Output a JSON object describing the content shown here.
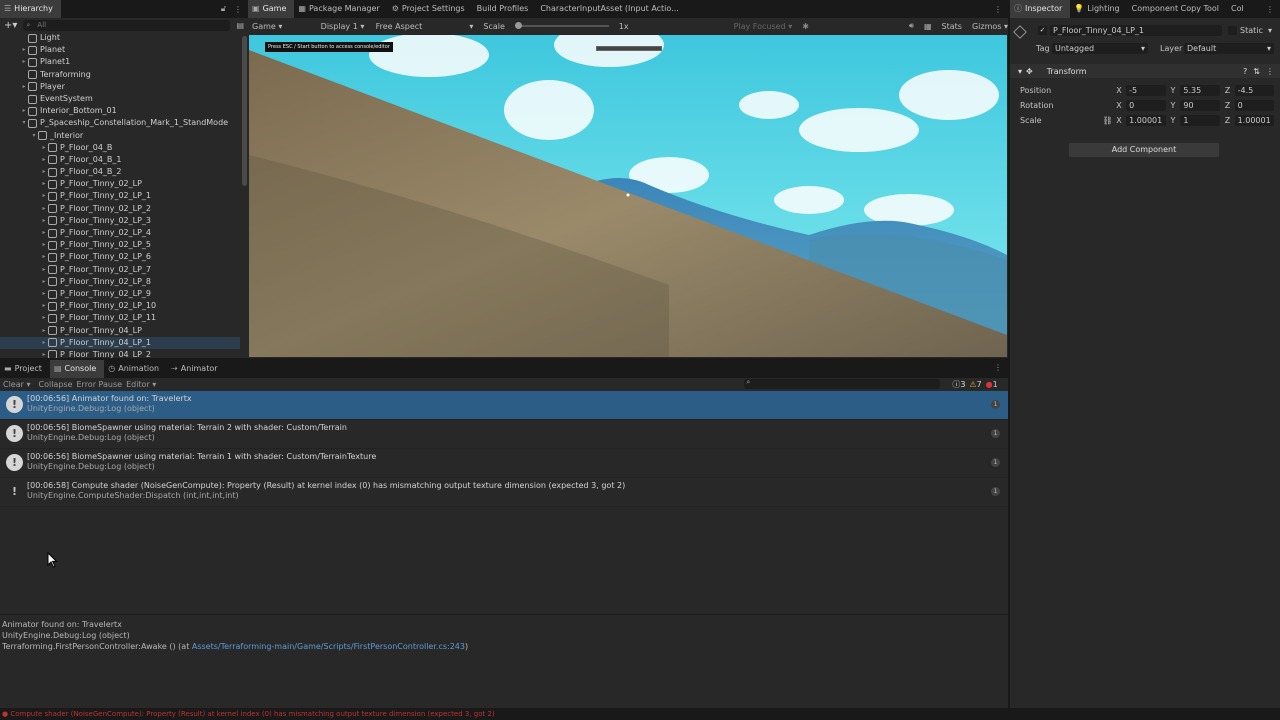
{
  "hierarchy": {
    "tab": "Hierarchy",
    "search_placeholder": "All",
    "items": [
      {
        "label": "Light",
        "indent": 1,
        "arrow": "",
        "sel": false
      },
      {
        "label": "Planet",
        "indent": 1,
        "arrow": "▸",
        "sel": false
      },
      {
        "label": "Planet1",
        "indent": 1,
        "arrow": "▸",
        "sel": false
      },
      {
        "label": "Terraforming",
        "indent": 1,
        "arrow": "",
        "sel": false
      },
      {
        "label": "Player",
        "indent": 1,
        "arrow": "▸",
        "sel": false
      },
      {
        "label": "EventSystem",
        "indent": 1,
        "arrow": "",
        "sel": false
      },
      {
        "label": "Interior_Bottom_01",
        "indent": 1,
        "arrow": "▸",
        "sel": false
      },
      {
        "label": "P_Spaceship_Constellation_Mark_1_StandMode",
        "indent": 1,
        "arrow": "▾",
        "sel": false
      },
      {
        "label": "_Interior",
        "indent": 2,
        "arrow": "▾",
        "sel": false
      },
      {
        "label": "P_Floor_04_B",
        "indent": 3,
        "arrow": "▸",
        "sel": false
      },
      {
        "label": "P_Floor_04_B_1",
        "indent": 3,
        "arrow": "▸",
        "sel": false
      },
      {
        "label": "P_Floor_04_B_2",
        "indent": 3,
        "arrow": "▸",
        "sel": false
      },
      {
        "label": "P_Floor_Tinny_02_LP",
        "indent": 3,
        "arrow": "▸",
        "sel": false
      },
      {
        "label": "P_Floor_Tinny_02_LP_1",
        "indent": 3,
        "arrow": "▸",
        "sel": false
      },
      {
        "label": "P_Floor_Tinny_02_LP_2",
        "indent": 3,
        "arrow": "▸",
        "sel": false
      },
      {
        "label": "P_Floor_Tinny_02_LP_3",
        "indent": 3,
        "arrow": "▸",
        "sel": false
      },
      {
        "label": "P_Floor_Tinny_02_LP_4",
        "indent": 3,
        "arrow": "▸",
        "sel": false
      },
      {
        "label": "P_Floor_Tinny_02_LP_5",
        "indent": 3,
        "arrow": "▸",
        "sel": false
      },
      {
        "label": "P_Floor_Tinny_02_LP_6",
        "indent": 3,
        "arrow": "▸",
        "sel": false
      },
      {
        "label": "P_Floor_Tinny_02_LP_7",
        "indent": 3,
        "arrow": "▸",
        "sel": false
      },
      {
        "label": "P_Floor_Tinny_02_LP_8",
        "indent": 3,
        "arrow": "▸",
        "sel": false
      },
      {
        "label": "P_Floor_Tinny_02_LP_9",
        "indent": 3,
        "arrow": "▸",
        "sel": false
      },
      {
        "label": "P_Floor_Tinny_02_LP_10",
        "indent": 3,
        "arrow": "▸",
        "sel": false
      },
      {
        "label": "P_Floor_Tinny_02_LP_11",
        "indent": 3,
        "arrow": "▸",
        "sel": false
      },
      {
        "label": "P_Floor_Tinny_04_LP",
        "indent": 3,
        "arrow": "▸",
        "sel": false
      },
      {
        "label": "P_Floor_Tinny_04_LP_1",
        "indent": 3,
        "arrow": "▸",
        "sel": true
      },
      {
        "label": "P_Floor_Tinny_04_LP_2",
        "indent": 3,
        "arrow": "▸",
        "sel": false
      }
    ]
  },
  "tabs_top": [
    {
      "label": "Game",
      "icon": "▣",
      "active": true
    },
    {
      "label": "Package Manager",
      "icon": "▦",
      "active": false
    },
    {
      "label": "Project Settings",
      "icon": "⚙",
      "active": false
    },
    {
      "label": "Build Profiles",
      "icon": "",
      "active": false
    },
    {
      "label": "CharacterInputAsset (Input Actio...",
      "icon": "",
      "active": false
    }
  ],
  "game_toolbar": {
    "mode": "Game",
    "display": "Display 1",
    "aspect": "Free Aspect",
    "scale_label": "Scale",
    "scale_value": "1x",
    "play_focused": "Play Focused",
    "stats": "Stats",
    "gizmos": "Gizmos"
  },
  "game_view": {
    "overlay_text": "Press ESC / Start button to access console/editor",
    "sky_color": "#49d3dd"
  },
  "inspector": {
    "tabs": [
      {
        "label": "Inspector",
        "icon": "ⓘ",
        "active": true
      },
      {
        "label": "Lighting",
        "icon": "💡",
        "active": false
      },
      {
        "label": "Component Copy Tool",
        "icon": "",
        "active": false
      },
      {
        "label": "Col",
        "icon": "",
        "active": false
      }
    ],
    "object_name": "P_Floor_Tinny_04_LP_1",
    "static_label": "Static",
    "tag_label": "Tag",
    "tag_value": "Untagged",
    "layer_label": "Layer",
    "layer_value": "Default",
    "component_title": "Transform",
    "position_label": "Position",
    "rotation_label": "Rotation",
    "scale_label": "Scale",
    "position": {
      "x": "-5",
      "y": "5.35",
      "z": "-4.5"
    },
    "rotation": {
      "x": "0",
      "y": "90",
      "z": "0"
    },
    "scale": {
      "x": "1.00001",
      "y": "1",
      "z": "1.00001"
    },
    "add_component": "Add Component"
  },
  "console": {
    "tabs": [
      {
        "label": "Project",
        "icon": "▬",
        "active": false
      },
      {
        "label": "Console",
        "icon": "▤",
        "active": true
      },
      {
        "label": "Animation",
        "icon": "◷",
        "active": false
      },
      {
        "label": "Animator",
        "icon": "⇢",
        "active": false
      }
    ],
    "toolbar": {
      "clear": "Clear",
      "collapse": "Collapse",
      "error_pause": "Error Pause",
      "editor": "Editor"
    },
    "counts": {
      "info": "3",
      "warn": "7",
      "error": "1"
    },
    "entries": [
      {
        "line1": "[00:06:56] Animator found on: Travelertx",
        "line2": "UnityEngine.Debug:Log (object)",
        "type": "info",
        "count": "1",
        "selected": true
      },
      {
        "line1": "[00:06:56] BiomeSpawner using material: Terrain 2 with shader: Custom/Terrain",
        "line2": "UnityEngine.Debug:Log (object)",
        "type": "info",
        "count": "1",
        "selected": false
      },
      {
        "line1": "[00:06:56] BiomeSpawner using material: Terrain 1 with shader: Custom/TerrainTexture",
        "line2": "UnityEngine.Debug:Log (object)",
        "type": "info",
        "count": "1",
        "selected": false
      },
      {
        "line1": "[00:06:58] Compute shader (NoiseGenCompute): Property (Result) at kernel index (0) has mismatching output texture dimension (expected 3, got 2)",
        "line2": "UnityEngine.ComputeShader:Dispatch (int,int,int,int)",
        "type": "error",
        "count": "1",
        "selected": false
      }
    ],
    "detail": {
      "line1": "Animator found on: Travelertx",
      "line2": "UnityEngine.Debug:Log (object)",
      "line3_prefix": "Terraforming.FirstPersonController:Awake () (at ",
      "line3_link": "Assets/Terraforming-main/Game/Scripts/FirstPersonController.cs:243",
      "line3_suffix": ")"
    }
  },
  "status_bar": {
    "text": "Compute shader (NoiseGenCompute): Property (Result) at kernel index (0) has mismatching output texture dimension (expected 3, got 2)"
  }
}
